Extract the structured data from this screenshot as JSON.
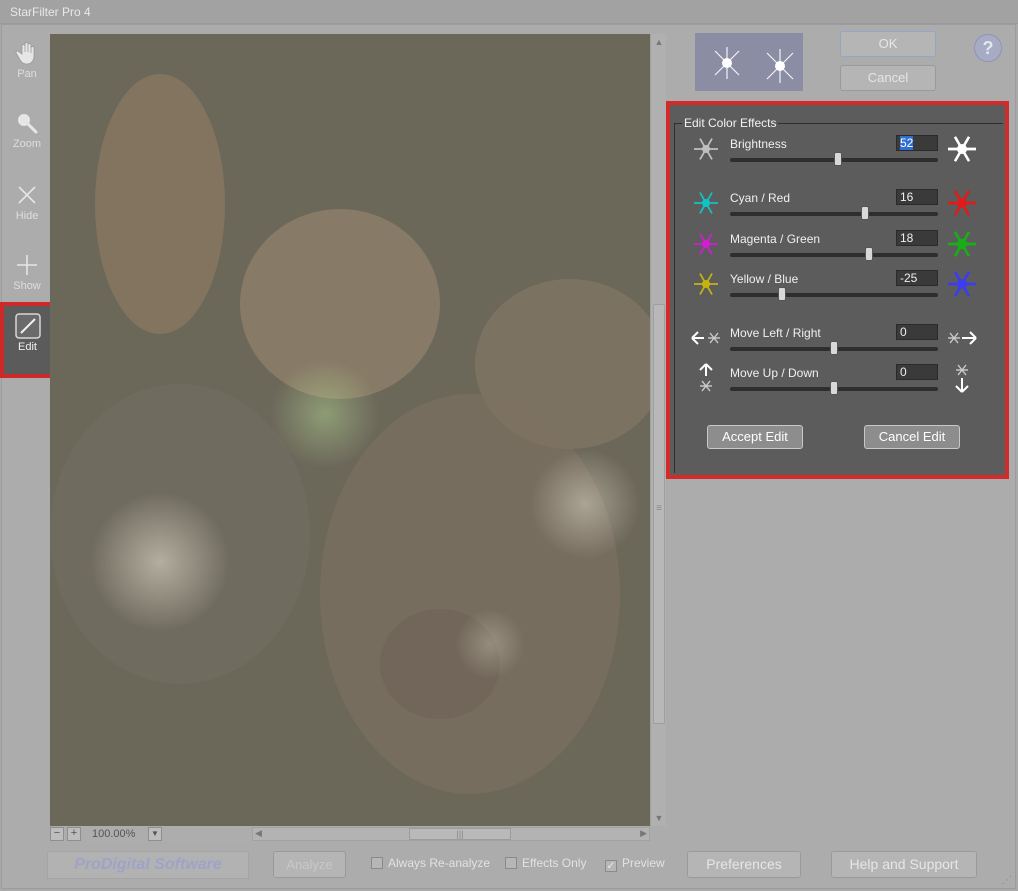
{
  "window": {
    "title": "StarFilter Pro 4"
  },
  "toolbar": {
    "tools": [
      {
        "label": "Pan",
        "icon": "hand-icon"
      },
      {
        "label": "Zoom",
        "icon": "magnifier-icon"
      },
      {
        "label": "Hide",
        "icon": "x-icon"
      },
      {
        "label": "Show",
        "icon": "plus-icon"
      },
      {
        "label": "Edit",
        "icon": "pen-icon",
        "active": true
      }
    ]
  },
  "viewer": {
    "zoom": "100.00%",
    "zoom_out": "−",
    "zoom_in": "+",
    "scroll_grip": "|||",
    "vscroll_grip": "≡"
  },
  "dialog": {
    "ok_label": "OK",
    "cancel_label": "Cancel",
    "help_label": "?"
  },
  "edit_panel": {
    "title": "Edit Color Effects",
    "rows": [
      {
        "label": "Brightness",
        "value": "52",
        "position": 0.52,
        "selected": true,
        "left_color": "#bfbfbf",
        "right_color": "#ffffff"
      },
      {
        "label": "Cyan / Red",
        "value": "16",
        "position": 0.65,
        "left_color": "#11c4c4",
        "right_color": "#e01b1b"
      },
      {
        "label": "Magenta / Green",
        "value": "18",
        "position": 0.67,
        "left_color": "#d21dd2",
        "right_color": "#16b016"
      },
      {
        "label": "Yellow / Blue",
        "value": "-25",
        "position": 0.25,
        "left_color": "#c4b410",
        "right_color": "#3c3cf0"
      },
      {
        "label": "Move Left / Right",
        "value": "0",
        "position": 0.5,
        "left_icon": "arrow-left-star-icon",
        "right_icon": "star-arrow-right-icon"
      },
      {
        "label": "Move Up / Down",
        "value": "0",
        "position": 0.5,
        "left_icon": "arrow-up-star-icon",
        "right_icon": "star-arrow-down-icon"
      }
    ],
    "accept_label": "Accept Edit",
    "cancel_label": "Cancel Edit"
  },
  "bottom": {
    "logo": "ProDigital Software",
    "analyze_label": "Analyze",
    "always_reanalyze_label": "Always Re-analyze",
    "always_reanalyze_checked": false,
    "effects_only_label": "Effects Only",
    "effects_only_checked": false,
    "preview_label": "Preview",
    "preview_checked": true,
    "preview_check_glyph": "✓",
    "preferences_label": "Preferences",
    "help_support_label": "Help and Support"
  }
}
